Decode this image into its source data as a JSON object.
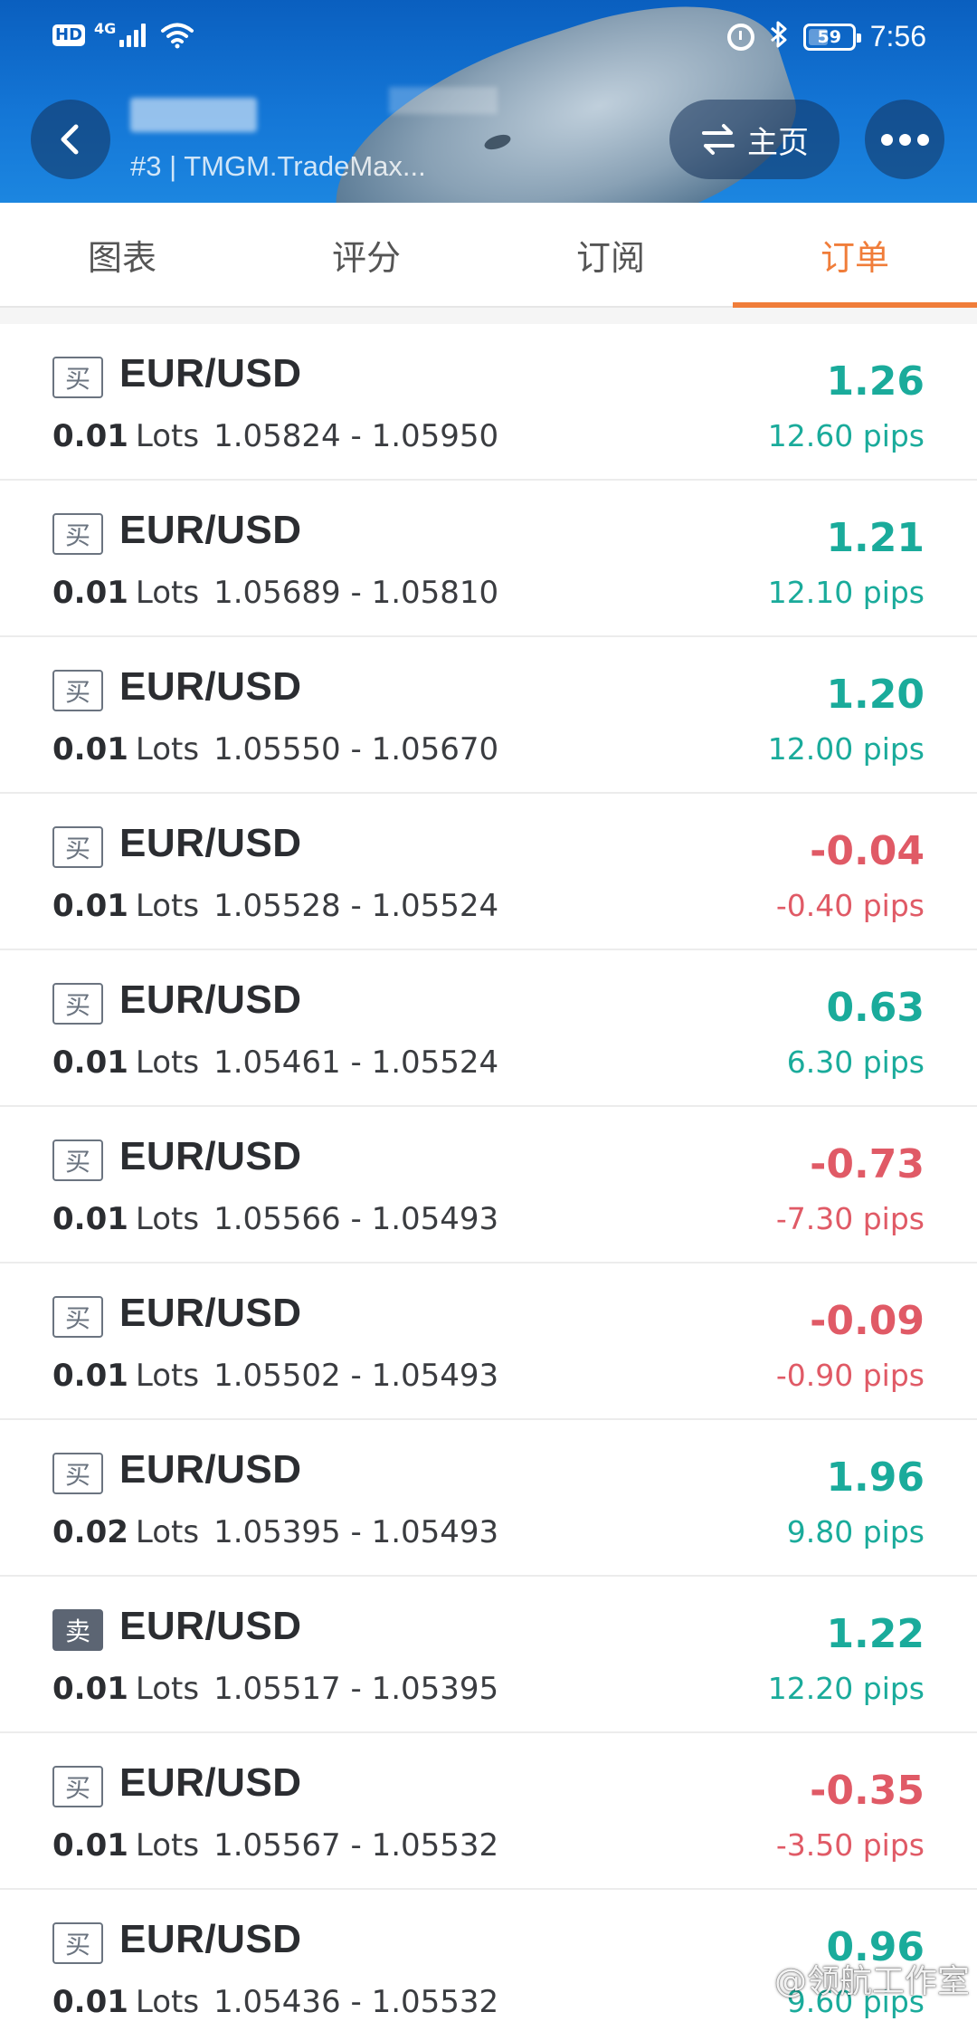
{
  "status_bar": {
    "hd": "HD",
    "network": "4G",
    "battery": "59",
    "time": "7:56"
  },
  "header": {
    "subtitle": "#3 | TMGM.TradeMax...",
    "home_label": "主页"
  },
  "tabs": [
    {
      "label": "图表",
      "active": false
    },
    {
      "label": "评分",
      "active": false
    },
    {
      "label": "订阅",
      "active": false
    },
    {
      "label": "订单",
      "active": true
    }
  ],
  "colors": {
    "positive": "#1aab9b",
    "negative": "#e05a66",
    "accent": "#f07d3a",
    "header_blue": "#0a5fbf"
  },
  "orders": [
    {
      "side": "买",
      "symbol": "EUR/USD",
      "lots": "0.01",
      "lots_unit": "Lots",
      "prices": "1.05824 - 1.05950",
      "profit": "1.26",
      "pips": "12.60 pips",
      "positive": true
    },
    {
      "side": "买",
      "symbol": "EUR/USD",
      "lots": "0.01",
      "lots_unit": "Lots",
      "prices": "1.05689 - 1.05810",
      "profit": "1.21",
      "pips": "12.10 pips",
      "positive": true
    },
    {
      "side": "买",
      "symbol": "EUR/USD",
      "lots": "0.01",
      "lots_unit": "Lots",
      "prices": "1.05550 - 1.05670",
      "profit": "1.20",
      "pips": "12.00 pips",
      "positive": true
    },
    {
      "side": "买",
      "symbol": "EUR/USD",
      "lots": "0.01",
      "lots_unit": "Lots",
      "prices": "1.05528 - 1.05524",
      "profit": "-0.04",
      "pips": "-0.40 pips",
      "positive": false
    },
    {
      "side": "买",
      "symbol": "EUR/USD",
      "lots": "0.01",
      "lots_unit": "Lots",
      "prices": "1.05461 - 1.05524",
      "profit": "0.63",
      "pips": "6.30 pips",
      "positive": true
    },
    {
      "side": "买",
      "symbol": "EUR/USD",
      "lots": "0.01",
      "lots_unit": "Lots",
      "prices": "1.05566 - 1.05493",
      "profit": "-0.73",
      "pips": "-7.30 pips",
      "positive": false
    },
    {
      "side": "买",
      "symbol": "EUR/USD",
      "lots": "0.01",
      "lots_unit": "Lots",
      "prices": "1.05502 - 1.05493",
      "profit": "-0.09",
      "pips": "-0.90 pips",
      "positive": false
    },
    {
      "side": "买",
      "symbol": "EUR/USD",
      "lots": "0.02",
      "lots_unit": "Lots",
      "prices": "1.05395 - 1.05493",
      "profit": "1.96",
      "pips": "9.80 pips",
      "positive": true
    },
    {
      "side": "卖",
      "symbol": "EUR/USD",
      "lots": "0.01",
      "lots_unit": "Lots",
      "prices": "1.05517 - 1.05395",
      "profit": "1.22",
      "pips": "12.20 pips",
      "positive": true
    },
    {
      "side": "买",
      "symbol": "EUR/USD",
      "lots": "0.01",
      "lots_unit": "Lots",
      "prices": "1.05567 - 1.05532",
      "profit": "-0.35",
      "pips": "-3.50 pips",
      "positive": false
    },
    {
      "side": "买",
      "symbol": "EUR/USD",
      "lots": "0.01",
      "lots_unit": "Lots",
      "prices": "1.05436 - 1.05532",
      "profit": "0.96",
      "pips": "9.60 pips",
      "positive": true
    }
  ],
  "watermark": "@领航工作室"
}
